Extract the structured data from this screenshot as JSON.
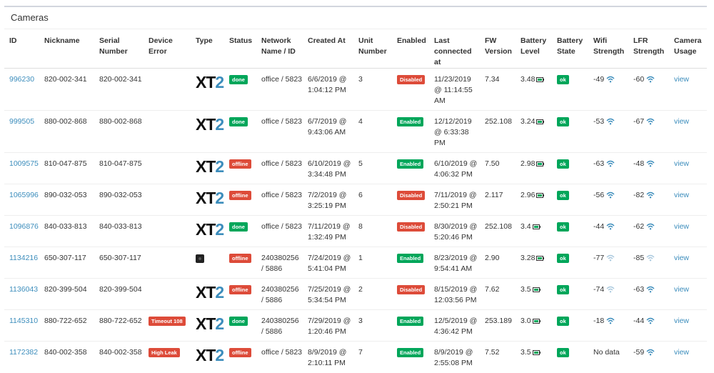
{
  "panel": {
    "title": "Cameras"
  },
  "columns": [
    "ID",
    "Nickname",
    "Serial Number",
    "Device Error",
    "Type",
    "Status",
    "Network Name / ID",
    "Created At",
    "Unit Number",
    "Enabled",
    "Last connected at",
    "FW Version",
    "Battery Level",
    "Battery State",
    "Wifi Strength",
    "LFR Strength",
    "Camera Usage"
  ],
  "rows": [
    {
      "id": "996230",
      "nickname": "820-002-341",
      "serial": "820-002-341",
      "error": "",
      "type": "xt2",
      "status": "done",
      "network": "office / 5823",
      "created": "6/6/2019 @ 1:04:12 PM",
      "unit": "3",
      "enabled": "Disabled",
      "last": "11/23/2019 @ 11:14:55 AM",
      "fw": "7.34",
      "battery": "3.48",
      "bstate": "ok",
      "wifi": "-49",
      "wifi_strong": true,
      "lfr": "-60",
      "lfr_strong": true,
      "usage": "view",
      "height": "tall"
    },
    {
      "id": "999505",
      "nickname": "880-002-868",
      "serial": "880-002-868",
      "error": "",
      "type": "xt2",
      "status": "done",
      "network": "office / 5823",
      "created": "6/7/2019 @ 9:43:06 AM",
      "unit": "4",
      "enabled": "Enabled",
      "last": "12/12/2019 @ 6:33:38 PM",
      "fw": "252.108",
      "battery": "3.24",
      "bstate": "ok",
      "wifi": "-53",
      "wifi_strong": true,
      "lfr": "-67",
      "lfr_strong": true,
      "usage": "view",
      "height": "tall"
    },
    {
      "id": "1009575",
      "nickname": "810-047-875",
      "serial": "810-047-875",
      "error": "",
      "type": "xt2",
      "status": "offline",
      "network": "office / 5823",
      "created": "6/10/2019 @ 3:34:48 PM",
      "unit": "5",
      "enabled": "Enabled",
      "last": "6/10/2019 @ 4:06:32 PM",
      "fw": "7.50",
      "battery": "2.98",
      "bstate": "ok",
      "wifi": "-63",
      "wifi_strong": true,
      "lfr": "-48",
      "lfr_strong": true,
      "usage": "view",
      "height": "short"
    },
    {
      "id": "1065996",
      "nickname": "890-032-053",
      "serial": "890-032-053",
      "error": "",
      "type": "xt2",
      "status": "offline",
      "network": "office / 5823",
      "created": "7/2/2019 @ 3:25:19 PM",
      "unit": "6",
      "enabled": "Disabled",
      "last": "7/11/2019 @ 2:50:21 PM",
      "fw": "2.117",
      "battery": "2.96",
      "bstate": "ok",
      "wifi": "-56",
      "wifi_strong": true,
      "lfr": "-82",
      "lfr_strong": true,
      "usage": "view",
      "height": "short"
    },
    {
      "id": "1096876",
      "nickname": "840-033-813",
      "serial": "840-033-813",
      "error": "",
      "type": "xt2",
      "status": "done",
      "network": "office / 5823",
      "created": "7/11/2019 @ 1:32:49 PM",
      "unit": "8",
      "enabled": "Disabled",
      "last": "8/30/2019 @ 5:20:46 PM",
      "fw": "252.108",
      "battery": "3.4",
      "bstate": "ok",
      "wifi": "-44",
      "wifi_strong": true,
      "lfr": "-62",
      "lfr_strong": true,
      "usage": "view",
      "height": "short"
    },
    {
      "id": "1134216",
      "nickname": "650-307-117",
      "serial": "650-307-117",
      "error": "",
      "type": "camera",
      "status": "offline",
      "network": "240380256 / 5886",
      "created": "7/24/2019 @ 5:41:04 PM",
      "unit": "1",
      "enabled": "Enabled",
      "last": "8/23/2019 @ 9:54:41 AM",
      "fw": "2.90",
      "battery": "3.28",
      "bstate": "ok",
      "wifi": "-77",
      "wifi_strong": false,
      "lfr": "-85",
      "lfr_strong": false,
      "usage": "view",
      "height": "short"
    },
    {
      "id": "1136043",
      "nickname": "820-399-504",
      "serial": "820-399-504",
      "error": "",
      "type": "xt2",
      "status": "offline",
      "network": "240380256 / 5886",
      "created": "7/25/2019 @ 5:34:54 PM",
      "unit": "2",
      "enabled": "Disabled",
      "last": "8/15/2019 @ 12:03:56 PM",
      "fw": "7.62",
      "battery": "3.5",
      "bstate": "ok",
      "wifi": "-74",
      "wifi_strong": false,
      "lfr": "-63",
      "lfr_strong": true,
      "usage": "view",
      "height": "short"
    },
    {
      "id": "1145310",
      "nickname": "880-722-652",
      "serial": "880-722-652",
      "error": "Timeout 108",
      "type": "xt2",
      "status": "done",
      "network": "240380256 / 5886",
      "created": "7/29/2019 @ 1:20:46 PM",
      "unit": "3",
      "enabled": "Enabled",
      "last": "12/5/2019 @ 4:36:42 PM",
      "fw": "253.189",
      "battery": "3.0",
      "bstate": "ok",
      "wifi": "-18",
      "wifi_strong": true,
      "lfr": "-44",
      "lfr_strong": true,
      "usage": "view",
      "height": "short"
    },
    {
      "id": "1172382",
      "nickname": "840-002-358",
      "serial": "840-002-358",
      "error": "High Leak",
      "type": "xt2",
      "status": "offline",
      "network": "office / 5823",
      "created": "8/9/2019 @ 2:10:11 PM",
      "unit": "7",
      "enabled": "Enabled",
      "last": "8/9/2019 @ 2:55:08 PM",
      "fw": "7.52",
      "battery": "3.5",
      "bstate": "ok",
      "wifi": "No data",
      "wifi_strong": null,
      "lfr": "-59",
      "lfr_strong": true,
      "usage": "view",
      "height": "short"
    }
  ]
}
